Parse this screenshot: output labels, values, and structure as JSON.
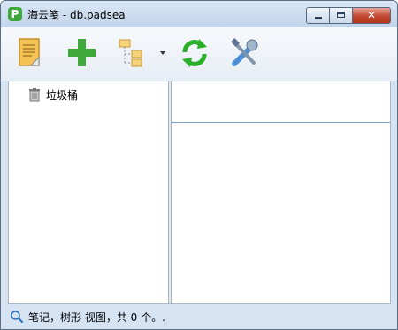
{
  "window": {
    "title": "海云笺 - db.padsea",
    "app_icon_letter": "P",
    "close_symbol": "✕"
  },
  "toolbar": {
    "buttons": [
      {
        "name": "new-note",
        "icon": "note-icon"
      },
      {
        "name": "add",
        "icon": "plus-icon",
        "color": "#3ea83a"
      },
      {
        "name": "tree-view",
        "icon": "tree-folder-icon",
        "has_dropdown": true
      },
      {
        "name": "refresh",
        "icon": "refresh-icon",
        "color": "#2bb02a"
      },
      {
        "name": "settings",
        "icon": "tools-icon",
        "color": "#4b8fd6"
      }
    ]
  },
  "tree": {
    "items": [
      {
        "label": "垃圾桶",
        "icon": "trash-icon"
      }
    ]
  },
  "status": {
    "text": "笔记，树形 视图，共 0 个。.",
    "icon": "search-icon"
  },
  "colors": {
    "frame": "#d6e3f3",
    "pane_border": "#a9b3be",
    "divider_blue": "#7f9fc2"
  }
}
